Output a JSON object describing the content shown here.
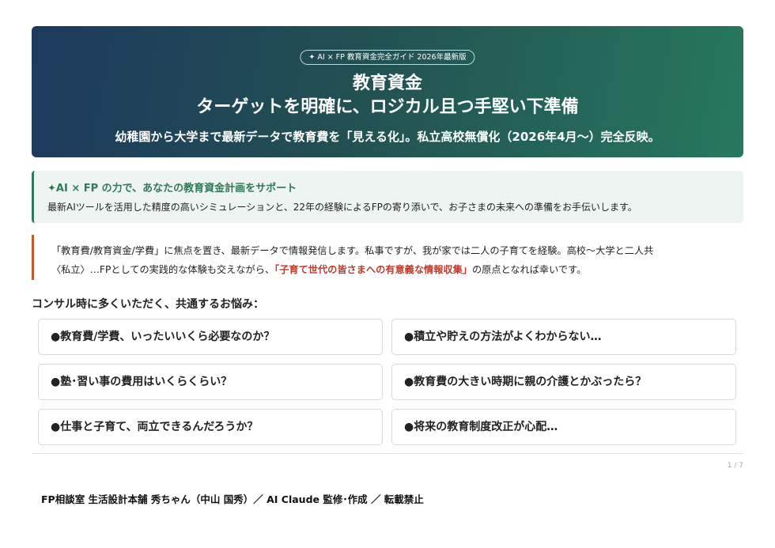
{
  "hero": {
    "badge": "✦ AI × FP 教育資金完全ガイド 2026年最新版",
    "title_line1": "教育資金",
    "title_line2": "ターゲットを明確に、ロジカル且つ手堅い下準備",
    "subtitle": "幼稚園から大学まで最新データで教育費を「見える化」。私立高校無償化（2026年4月〜）完全反映。"
  },
  "callout": {
    "heading": "✦AI × FP の力で、あなたの教育資金計画をサポート",
    "body": "最新AIツールを活用した精度の高いシミュレーションと、22年の経験によるFPの寄り添いで、お子さまの未来への準備をお手伝いします。"
  },
  "intro": {
    "line1": "「教育費/教育資金/学費」に焦点を置き、最新データで情報発信します。私事ですが、我が家では二人の子育てを経験。高校〜大学と二人共",
    "line2_before": "〈私立〉…FPとしての実践的な体験も交えながら、",
    "line2_highlight": "「子育て世代の皆さまへの有意義な情報収集」",
    "line2_after": "の原点となれば幸いです。"
  },
  "concerns": {
    "heading": "コンサル時に多くいただく、共通するお悩み：",
    "items": [
      "●教育費/学費、いったいいくら必要なのか？",
      "●積立や貯えの方法がよくわからない…",
      "●塾･習い事の費用はいくらくらい？",
      "●教育費の大きい時期に親の介護とかぶったら？",
      "●仕事と子育て、両立できるんだろうか？",
      "●将来の教育制度改正が心配…"
    ]
  },
  "page_number": "1 / 7",
  "footer": "FP相談室 生活設計本舗 秀ちゃん（中山 国秀）／ AI Claude 監修･作成 ／ 転載禁止",
  "colors": {
    "hero_gradient_start": "#1d3a5e",
    "hero_gradient_end": "#27785e",
    "accent_green": "#2f7a5a",
    "accent_orange": "#c8552c",
    "highlight_red": "#c0392b"
  }
}
